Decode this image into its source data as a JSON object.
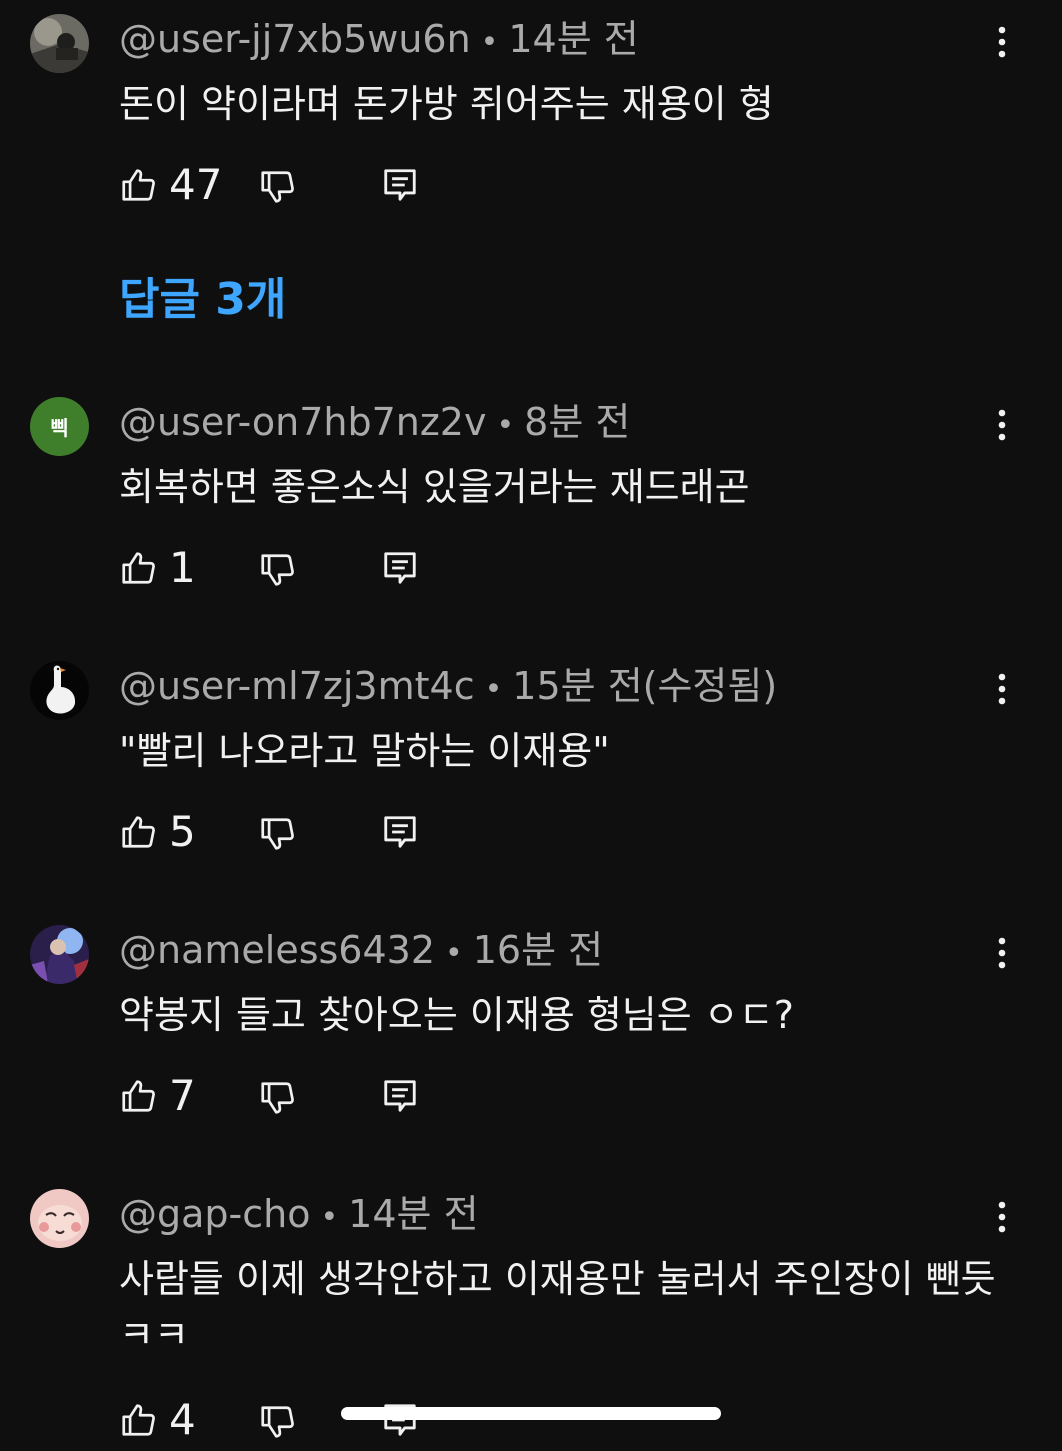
{
  "colors": {
    "background": "#0f0f0f",
    "text_primary": "#f1f1f1",
    "text_secondary": "#aaaaaa",
    "link": "#3ea6ff"
  },
  "parent_comment": {
    "author": "@user-jj7xb5wu6n",
    "separator": "•",
    "time": "14분 전",
    "text": "돈이 약이라며 돈가방 쥐어주는 재용이 형",
    "likes": "47",
    "avatar_icon": "photo-avatar-icon"
  },
  "replies_toggle": {
    "label": "답글 3개"
  },
  "replies": [
    {
      "author": "@user-on7hb7nz2v",
      "separator": "•",
      "time": "8분 전",
      "text": "회복하면 좋은소식 있을거라는 재드래곤",
      "likes": "1",
      "avatar_letter": "삑"
    },
    {
      "author": "@user-ml7zj3mt4c",
      "separator": "•",
      "time": "15분 전(수정됨)",
      "text": "\"빨리 나오라고 말하는 이재용\"",
      "likes": "5",
      "avatar_icon": "goose-avatar-icon"
    },
    {
      "author": "@nameless6432",
      "separator": "•",
      "time": "16분 전",
      "text": "약봉지 들고 찾아오는 이재용 형님은 ㅇㄷ?",
      "likes": "7",
      "avatar_icon": "character-avatar-icon"
    },
    {
      "author": "@gap-cho",
      "separator": "•",
      "time": "14분 전",
      "text": "사람들 이제 생각안하고 이재용만 눌러서 주인장이 뺀듯ㅋㅋ",
      "likes": "4",
      "avatar_icon": "cartoon-face-avatar-icon"
    }
  ]
}
